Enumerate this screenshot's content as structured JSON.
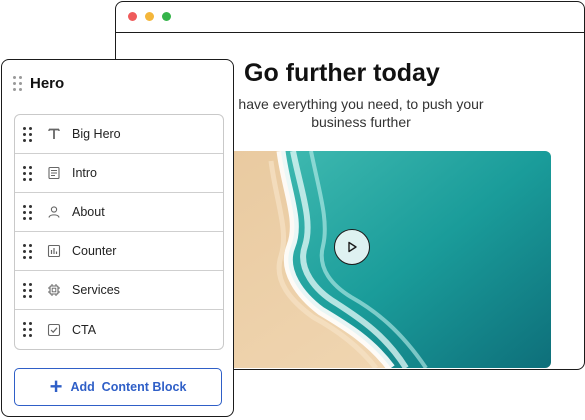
{
  "browser": {
    "title": "Go further today",
    "subtitle": "have everything you need, to push your business further",
    "media": {
      "type": "video",
      "play_icon": "play-icon"
    }
  },
  "panel": {
    "title": "Hero",
    "items": [
      {
        "label": "Big Hero",
        "icon": "text-icon"
      },
      {
        "label": "Intro",
        "icon": "document-icon"
      },
      {
        "label": "About",
        "icon": "user-icon"
      },
      {
        "label": "Counter",
        "icon": "bar-chart-icon"
      },
      {
        "label": "Services",
        "icon": "chip-icon"
      },
      {
        "label": "CTA",
        "icon": "checkbox-icon"
      }
    ],
    "add_button": "Add  Content Block"
  },
  "colors": {
    "accent": "#2f5fc7",
    "dot_red": "#ef5b5b",
    "dot_yellow": "#f4b63a",
    "dot_green": "#35b44a"
  }
}
